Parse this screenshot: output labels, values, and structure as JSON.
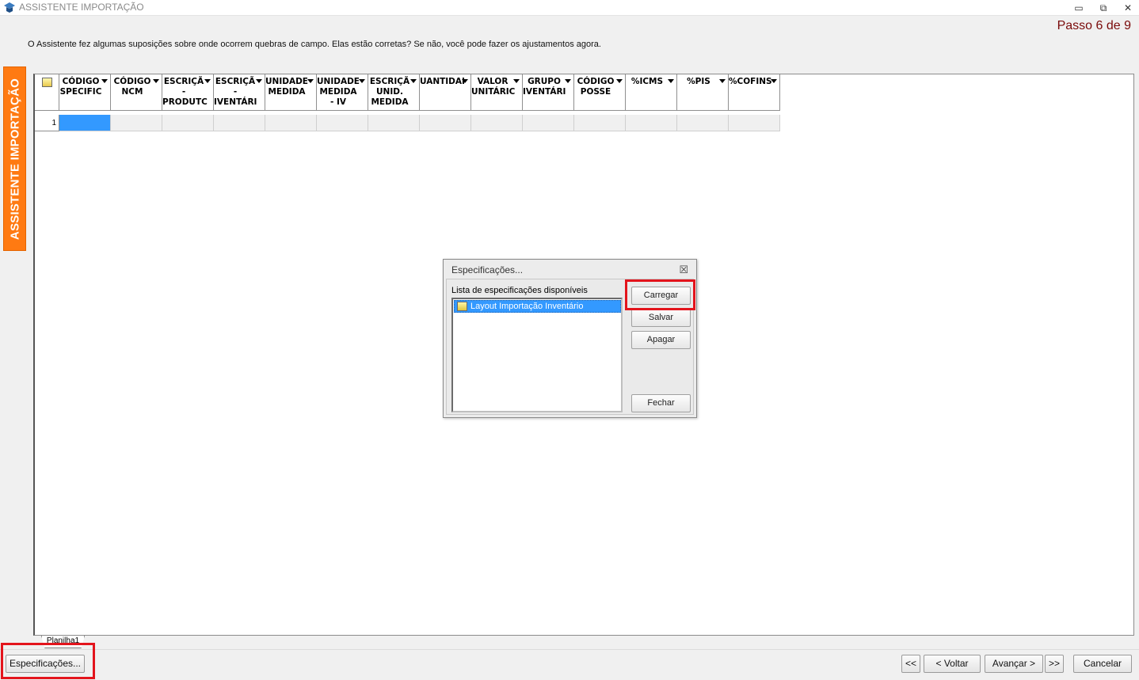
{
  "window": {
    "title": "ASSISTENTE IMPORTAÇÃO",
    "minimize_glyph": "▭",
    "restore_glyph": "⧉",
    "close_glyph": "✕"
  },
  "step": "Passo 6 de 9",
  "instruction": "O Assistente fez algumas suposições sobre onde ocorrem quebras de campo. Elas estão corretas? Se não, você pode fazer os ajustamentos agora.",
  "side_tab": "ASSISTENTE IMPORTAÇÃO",
  "grid": {
    "columns": [
      {
        "label": "CÓDIGO\nSPECIFIC"
      },
      {
        "label": "CÓDIGO\nNCM"
      },
      {
        "label": "ESCRIÇÃ\n-\nPRODUTC"
      },
      {
        "label": "ESCRIÇÃ\n-\nIVENTÁRI"
      },
      {
        "label": "UNIDADE\nMEDIDA"
      },
      {
        "label": "UNIDADE\nMEDIDA\n- IV"
      },
      {
        "label": "ESCRIÇÃ\nUNID.\nMEDIDA"
      },
      {
        "label": "UANTIDAI"
      },
      {
        "label": "VALOR\nUNITÁRIC"
      },
      {
        "label": "GRUPO\nIVENTÁRI"
      },
      {
        "label": "CÓDIGO\nPOSSE"
      },
      {
        "label": "%ICMS"
      },
      {
        "label": "%PIS"
      },
      {
        "label": "%COFINS"
      }
    ],
    "rows": [
      {
        "number": "1"
      }
    ]
  },
  "sheet_tab": "Planilha1",
  "bottom": {
    "specs_button": "Especificações...",
    "first_button": "<<",
    "back_button": "< Voltar",
    "next_button": "Avançar >",
    "last_button": ">>",
    "cancel_button": "Cancelar"
  },
  "dialog": {
    "title": "Especificações...",
    "close_glyph": "☒",
    "list_label": "Lista de especificações disponíveis",
    "items": [
      "Layout Importação Inventário"
    ],
    "load_button": "Carregar",
    "save_button": "Salvar",
    "delete_button": "Apagar",
    "close_button": "Fechar"
  },
  "colors": {
    "side_tab": "#ff7a12",
    "highlight": "#e3141c",
    "selection": "#3399ff",
    "step_text": "#7a0a0a"
  }
}
